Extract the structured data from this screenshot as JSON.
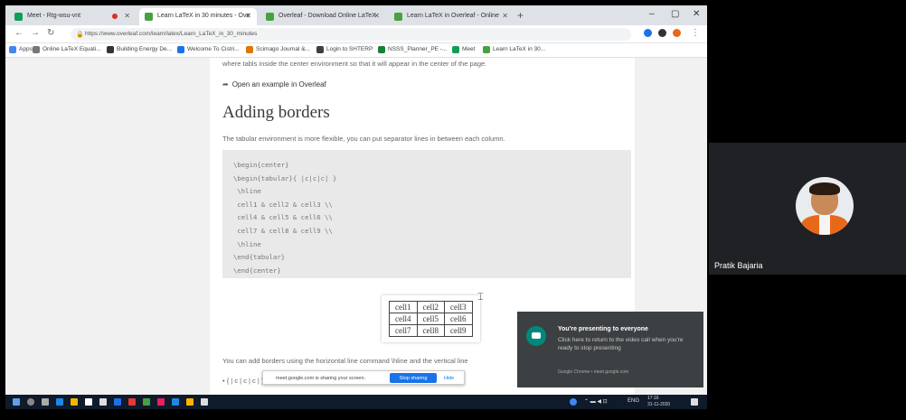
{
  "browser": {
    "tabs": [
      {
        "label": "Meet - Rtg-wsu-vnt",
        "fav_color": "#0f9d58",
        "active": false,
        "recording": true
      },
      {
        "label": "Learn LaTeX in 30 minutes - Ove",
        "fav_color": "#47a141",
        "active": true,
        "recording": false
      },
      {
        "label": "Overleaf - Download Online LaTeX",
        "fav_color": "#47a141",
        "active": false,
        "recording": false
      },
      {
        "label": "Learn LaTeX in Overleaf - Online",
        "fav_color": "#47a141",
        "active": false,
        "recording": false
      }
    ],
    "new_tab": "+",
    "window_controls": [
      "–",
      "▢",
      "✕"
    ],
    "url": "https://www.overleaf.com/learn/latex/Learn_LaTeX_in_30_minutes",
    "nav": {
      "back": "←",
      "forward": "→",
      "reload": "↻"
    },
    "bookmarks": [
      {
        "label": "Apps",
        "color": "#4285f4"
      },
      {
        "label": "Online LaTeX Equati...",
        "color": "#777"
      },
      {
        "label": "Building Energy De...",
        "color": "#333"
      },
      {
        "label": "Welcome To Cistri...",
        "color": "#1a73e8"
      },
      {
        "label": "Scimago Journal &...",
        "color": "#e37400"
      },
      {
        "label": "Login to SHTERP",
        "color": "#3c4043"
      },
      {
        "label": "NSSS_Planner_PE -...",
        "color": "#188038"
      },
      {
        "label": "Meet",
        "color": "#0f9d58"
      },
      {
        "label": "Learn LaTeX in 30...",
        "color": "#47a141"
      }
    ]
  },
  "article": {
    "intro": "where tabls inside the center environment so that it will appear in the center of the page.",
    "open_link": "Open an example in Overleaf",
    "heading": "Adding borders",
    "paragraph": "The tabular environment is more flexible, you can put separator lines in between each column.",
    "code_lines": [
      "\\begin{center}",
      "\\begin{tabular}{ |c|c|c| }",
      " \\hline",
      " cell1 & cell2 & cell3 \\\\",
      " cell4 & cell5 & cell6 \\\\",
      " cell7 & cell8 & cell9 \\\\",
      " \\hline",
      "\\end{tabular}",
      "\\end{center}"
    ],
    "result_table": [
      [
        "cell1",
        "cell2",
        "cell3"
      ],
      [
        "cell4",
        "cell5",
        "cell6"
      ],
      [
        "cell7",
        "cell8",
        "cell9"
      ]
    ],
    "after_text": "You can add borders using the horizontal line command \\hline and the vertical line",
    "after_text2": "• { | c | c | c | } ... a vertical line"
  },
  "share_bar": {
    "message": "meet.google.com is sharing your screen.",
    "stop_label": "Stop sharing",
    "hide_label": "Hide"
  },
  "toast": {
    "title": "You're presenting to everyone",
    "body": "Click here to return to the video call when you're ready to stop presenting",
    "footer": "Google Chrome • meet.google.com"
  },
  "taskbar": {
    "tray_time": "17:16",
    "tray_date": "31-11-2020",
    "tray_lang": "ENG"
  },
  "participant": {
    "name": "Pratik Bajaria"
  },
  "colors": {
    "accent": "#1a73e8",
    "toast_bg": "#3c4043",
    "panel_bg": "#202124"
  }
}
